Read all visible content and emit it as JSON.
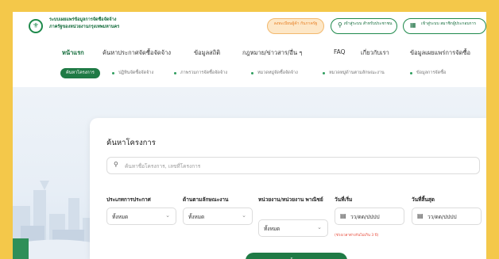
{
  "header": {
    "site_title_line1": "ระบบเผยแพร่ข้อมูลการจัดซื้อจัดจ้าง",
    "site_title_line2": "ภาครัฐของหน่วยงานกรุงเทพมหานคร",
    "register_label": "ลงทะเบียนผู้ค้า กับภาครัฐ",
    "officer_login": "เข้าสู่ระบบ สำหรับประชาชน",
    "operator_login": "เข้าสู่ระบบ สมาชิกผู้ประกอบการ"
  },
  "nav": {
    "items": [
      "หน้าแรก",
      "ค้นหาประกาศจัดซื้อจัดจ้าง",
      "ข้อมูลสถิติ",
      "กฎหมาย/ข่าวสาร/อื่น ๆ",
      "FAQ",
      "เกี่ยวกับเรา",
      "ข้อมูลเผยแพร่การจัดซื้อ"
    ]
  },
  "subnav": {
    "items": [
      "ค้นหาโครงการ",
      "ปฏิทินจัดซื้อจัดจ้าง",
      "ภาพรวมการจัดซื้อจัดจ้าง",
      "หมวดหมู่จัดซื้อจัดจ้าง",
      "หมวดหมู่ด้านตามลักษณะงาน",
      "ข้อมูลการจัดซื้อ"
    ]
  },
  "search": {
    "title": "ค้นหาโครงการ",
    "placeholder": "ค้นหาชื่อโครงการ, เลขที่โครงการ",
    "fields": {
      "type_label": "ประเภทการประกาศ",
      "type_value": "ทั้งหมด",
      "category_label": "ด้านตามลักษณะงาน",
      "category_value": "ทั้งหมด",
      "agency_label": "หน่วยงาน/หน่วยงาน พาณิชย์",
      "agency_value": "ทั้งหมด",
      "start_label": "วันที่เริ่ม",
      "start_value": "วว/ดด/ปปปป",
      "end_label": "วันที่สิ้นสุด",
      "end_value": "วว/ดด/ปปปป"
    },
    "hint": "(ช่วงเวลาต่างกันไม่เกิน 3 ปี)",
    "button_label": "ค้นหา"
  },
  "colors": {
    "primary": "#1f7a45",
    "accent": "#e67e22",
    "background": "#f4c84a"
  },
  "icons": {
    "logo": "seal-icon",
    "login": "user-icon",
    "operator": "building-icon",
    "search": "search-icon",
    "calendar": "calendar-icon",
    "chevron": "chevron-down-icon"
  }
}
